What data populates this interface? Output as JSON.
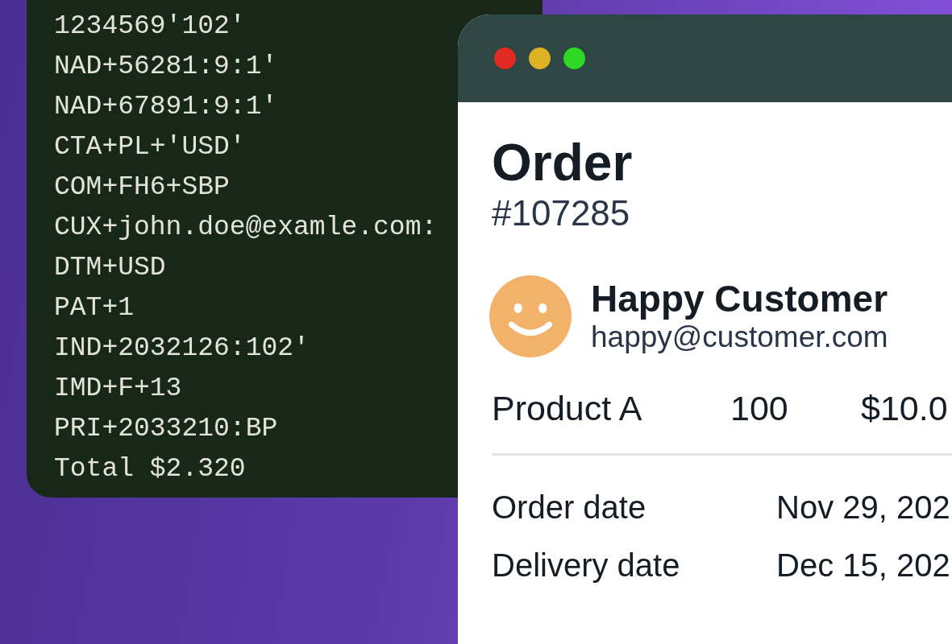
{
  "terminal": {
    "lines": [
      "1234569'102'",
      "NAD+56281:9:1'",
      "NAD+67891:9:1'",
      "CTA+PL+'USD'",
      "COM+FH6+SBP",
      "CUX+john.doe@examle.com:",
      "DTM+USD",
      "PAT+1",
      "IND+2032126:102'",
      "IMD+F+13",
      "PRI+2033210:BP",
      "Total $2.320"
    ]
  },
  "window": {
    "controls": [
      {
        "color": "#e02a22"
      },
      {
        "color": "#ddb224"
      },
      {
        "color": "#2ed825"
      }
    ],
    "title": "Order",
    "order_number": "#107285",
    "customer": {
      "name": "Happy Customer",
      "email": "happy@customer.com"
    },
    "items": [
      {
        "product": "Product A",
        "quantity": "100",
        "price": "$10.0"
      }
    ],
    "details": [
      {
        "label": "Order date",
        "value": "Nov 29, 202"
      },
      {
        "label": "Delivery date",
        "value": "Dec 15, 202"
      }
    ]
  }
}
